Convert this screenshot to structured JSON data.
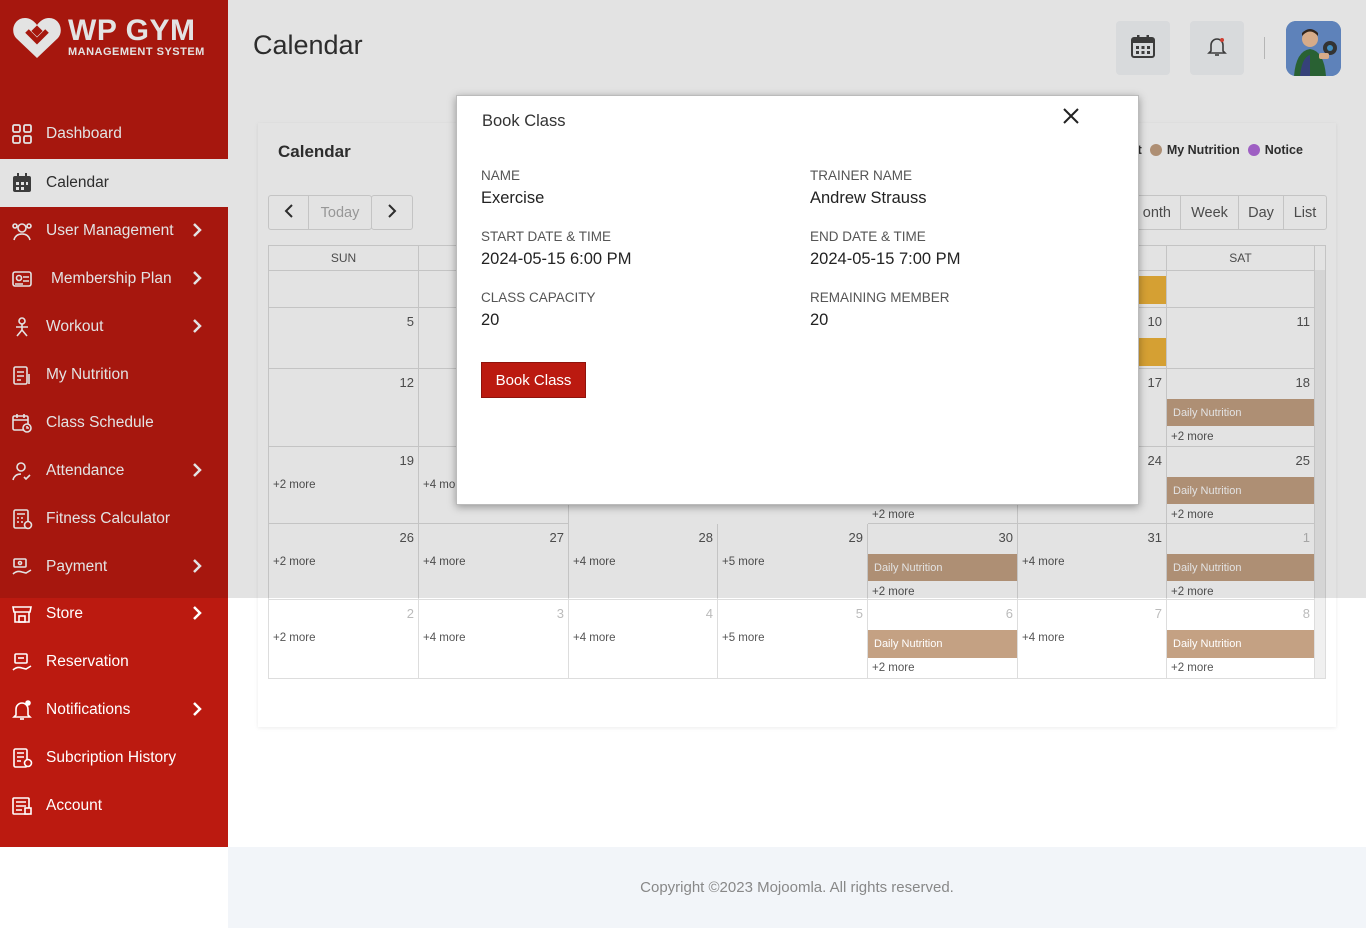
{
  "brand": {
    "title": "WP GYM",
    "subtitle": "MANAGEMENT SYSTEM"
  },
  "sidebar": {
    "items": [
      {
        "label": "Dashboard",
        "icon": "dashboard-grid-icon",
        "chevron": false
      },
      {
        "label": "Calendar",
        "icon": "calendar-icon",
        "chevron": false,
        "active": true
      },
      {
        "label": "User Management",
        "icon": "users-gear-icon",
        "chevron": true
      },
      {
        "label": "Membership Plan",
        "icon": "membership-card-icon",
        "chevron": true
      },
      {
        "label": "Workout",
        "icon": "workout-icon",
        "chevron": true
      },
      {
        "label": "My Nutrition",
        "icon": "nutrition-icon",
        "chevron": false
      },
      {
        "label": "Class Schedule",
        "icon": "class-schedule-icon",
        "chevron": false
      },
      {
        "label": "Attendance",
        "icon": "attendance-user-icon",
        "chevron": true
      },
      {
        "label": "Fitness Calculator",
        "icon": "calculator-icon",
        "chevron": false
      },
      {
        "label": "Payment",
        "icon": "payment-icon",
        "chevron": true
      },
      {
        "label": "Store",
        "icon": "store-icon",
        "chevron": true
      },
      {
        "label": "Reservation",
        "icon": "reservation-icon",
        "chevron": false
      },
      {
        "label": "Notifications",
        "icon": "bell-icon",
        "chevron": true
      },
      {
        "label": "Subcription History",
        "icon": "history-icon",
        "chevron": false
      },
      {
        "label": "Account",
        "icon": "account-icon",
        "chevron": false
      }
    ]
  },
  "header": {
    "title": "Calendar"
  },
  "calendar": {
    "card_title": "Calendar",
    "legend": [
      {
        "label": "ut",
        "color": null
      },
      {
        "label": "My Nutrition",
        "color": "#c4a183"
      },
      {
        "label": "Notice",
        "color": "#b26bdc"
      }
    ],
    "today_label": "Today",
    "view_buttons": [
      "onth",
      "Week",
      "Day",
      "List"
    ],
    "dow": [
      "SUN",
      "",
      "",
      "",
      "",
      "",
      "SAT"
    ],
    "event_label": "Daily Nutrition",
    "rows": [
      [
        "",
        "",
        "",
        "",
        "",
        "",
        ""
      ],
      [
        "5",
        "",
        "",
        "",
        "",
        "10",
        "11"
      ],
      [
        "12",
        "",
        "",
        "",
        "",
        "17",
        "18"
      ],
      [
        "19",
        "",
        "",
        "",
        "",
        "24",
        "25"
      ],
      [
        "26",
        "27",
        "28",
        "29",
        "30",
        "31",
        "1"
      ],
      [
        "2",
        "3",
        "4",
        "5",
        "6",
        "7",
        "8"
      ]
    ],
    "more": {
      "m2": "+2 more",
      "m4": "+4 more",
      "m5": "+5 more",
      "m4p": "+4 mo"
    }
  },
  "modal": {
    "title": "Book Class",
    "name_label": "NAME",
    "name_value": "Exercise",
    "trainer_label": "TRAINER NAME",
    "trainer_value": "Andrew Strauss",
    "start_label": "START DATE & TIME",
    "start_value": "2024-05-15 6:00 PM",
    "end_label": "END DATE & TIME",
    "end_value": "2024-05-15 7:00 PM",
    "capacity_label": "CLASS CAPACITY",
    "capacity_value": "20",
    "remaining_label": "REMAINING MEMBER",
    "remaining_value": "20",
    "button_label": "Book Class"
  },
  "footer": {
    "text": "Copyright ©2023 Mojoomla. All rights reserved."
  },
  "colors": {
    "sidebar": "#bb1a10",
    "accent": "#bb1a10",
    "event": "#c4a183",
    "event_yellow": "#f0b43a"
  }
}
